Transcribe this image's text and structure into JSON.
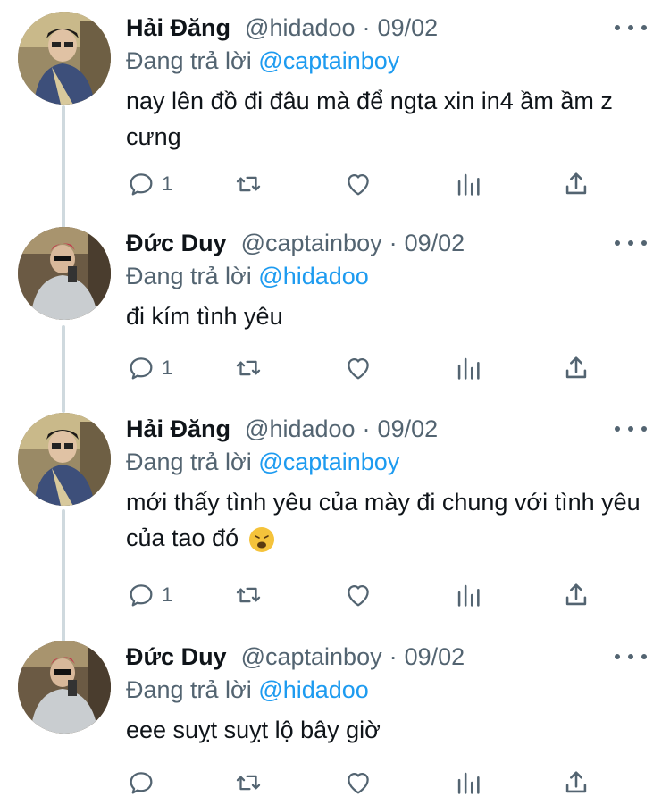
{
  "tweets": [
    {
      "name": "Hải Đăng",
      "handle": "@hidadoo",
      "separator": "·",
      "date": "09/02",
      "reply_prefix": "Đang trả lời",
      "reply_to": "@captainboy",
      "text": "nay lên đồ đi đâu mà để ngta xin in4 ầm ầm z cưng",
      "reply_count": "1"
    },
    {
      "name": "Đức Duy",
      "handle": "@captainboy",
      "separator": "·",
      "date": "09/02",
      "reply_prefix": "Đang trả lời",
      "reply_to": "@hidadoo",
      "text": "đi kím tình yêu",
      "reply_count": "1"
    },
    {
      "name": "Hải Đăng",
      "handle": "@hidadoo",
      "separator": "·",
      "date": "09/02",
      "reply_prefix": "Đang trả lời",
      "reply_to": "@captainboy",
      "text": "mới thấy tình yêu của mày đi chung với tình yêu của tao đó",
      "emoji": "weary-face-emoji",
      "reply_count": "1"
    },
    {
      "name": "Đức Duy",
      "handle": "@captainboy",
      "separator": "·",
      "date": "09/02",
      "reply_prefix": "Đang trả lời",
      "reply_to": "@hidadoo",
      "text": "eee suỵt suỵt lộ bây giờ",
      "reply_count": ""
    }
  ],
  "icons": {
    "reply": "reply-icon",
    "retweet": "retweet-icon",
    "like": "heart-icon",
    "views": "views-icon",
    "share": "share-icon",
    "more": "more-icon"
  },
  "colors": {
    "text": "#0f1419",
    "secondary": "#536471",
    "mention": "#1d9bf0",
    "thread_line": "#cfd9de"
  }
}
